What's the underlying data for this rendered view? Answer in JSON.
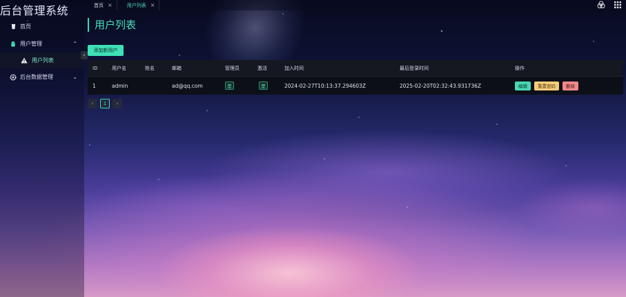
{
  "app": {
    "title": "后台管理系统"
  },
  "sidebar": {
    "items": [
      {
        "label": "首页",
        "icon": "cup-icon"
      },
      {
        "label": "用户管理",
        "icon": "android-icon",
        "chevron": "up"
      },
      {
        "label": "用户列表",
        "icon": "warning-triangle-icon",
        "sub": true,
        "active": true
      },
      {
        "label": "后台数据管理",
        "icon": "gear-icon",
        "chevron": "down"
      }
    ],
    "collapse_icon": "chevron-left-icon"
  },
  "tabs": [
    {
      "label": "首页",
      "active": false
    },
    {
      "label": "用户列表",
      "active": true
    }
  ],
  "top_icons": [
    "color-circles-icon",
    "grid-apps-icon"
  ],
  "page": {
    "title": "用户列表",
    "add_button": "添加新用户"
  },
  "table": {
    "columns": [
      "ID",
      "用户名",
      "姓名",
      "邮箱",
      "管理员",
      "激活",
      "加入时间",
      "最后登录时间",
      "操作"
    ],
    "rows": [
      {
        "id": "1",
        "username": "admin",
        "name": "",
        "email": "ad@qq.com",
        "admin": "是",
        "active": "是",
        "joined": "2024-02-27T10:13:37.294603Z",
        "last_login": "2025-02-20T02:32:43.931736Z",
        "actions": {
          "edit": "编辑",
          "reset": "重置密码",
          "delete": "删除"
        }
      }
    ]
  },
  "pagination": {
    "current": "1"
  },
  "colors": {
    "accent": "#3fe0b6",
    "warning": "#f5cd7a",
    "danger": "#f08a8a"
  }
}
